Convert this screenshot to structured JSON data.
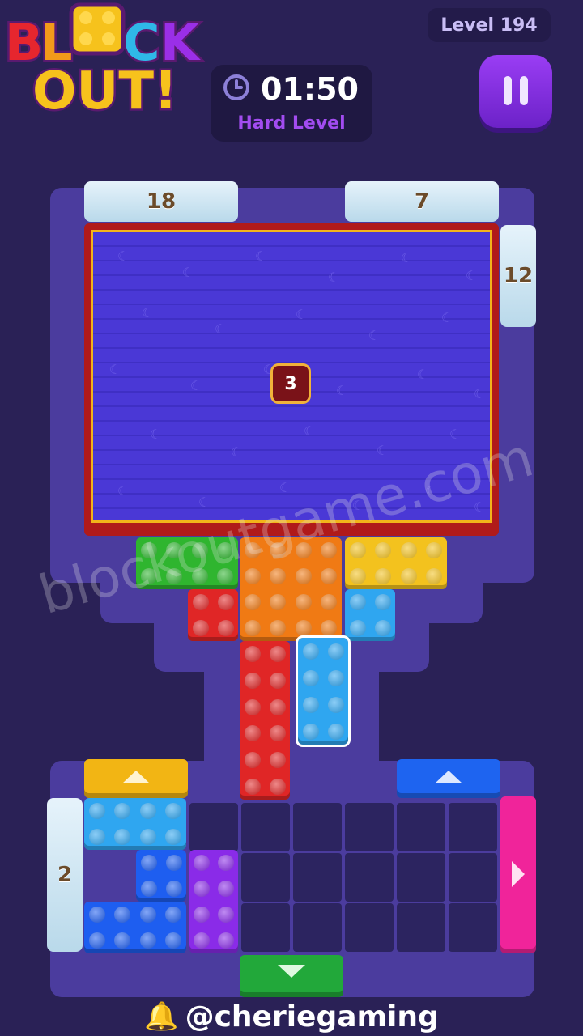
{
  "header": {
    "logo_line1": "BLOCK",
    "logo_line2": "OUT!",
    "level_label": "Level 194",
    "timer": "01:50",
    "difficulty": "Hard Level"
  },
  "board": {
    "counters": {
      "top_left": "18",
      "top_right": "7",
      "right": "12",
      "left": "2"
    },
    "target_badge": "3"
  },
  "watermark": "blockoutgame.com",
  "footer": {
    "handle": "@cheriegaming"
  },
  "colors": {
    "green": "#2fb52f",
    "orange": "#f07a14",
    "yellow": "#f3c21e",
    "red": "#e02626",
    "light_blue": "#2fa6f0",
    "blue": "#1e5ef0",
    "purple": "#8a2be8",
    "pink": "#f0249a",
    "gate_yellow": "#f2b514",
    "gate_blue": "#1e64f0",
    "gate_green": "#22a83a"
  }
}
